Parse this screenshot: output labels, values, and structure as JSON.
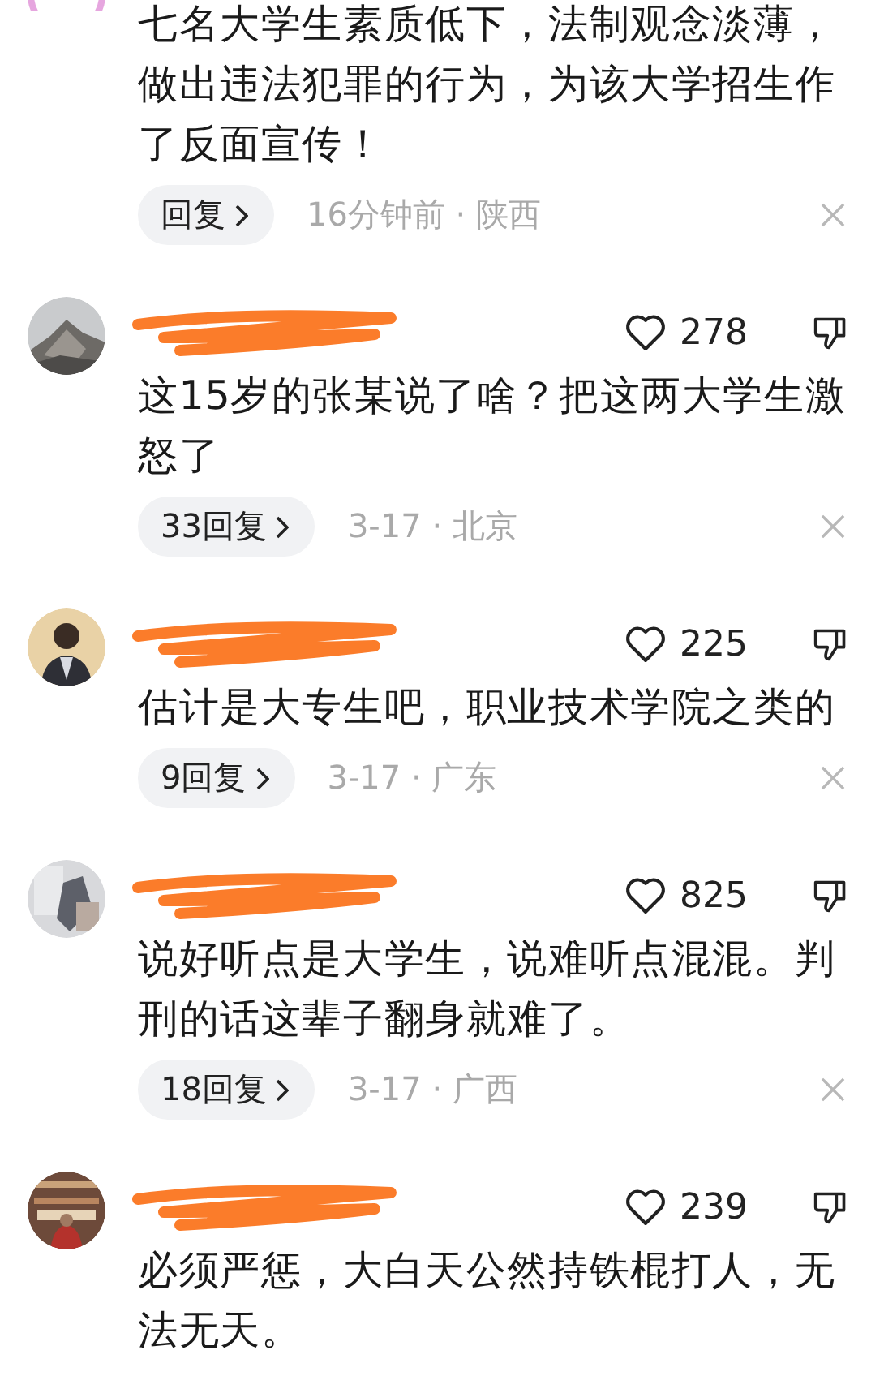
{
  "comments": [
    {
      "kind": "cut",
      "text": "七名大学生素质低下，法制观念淡薄，做出违法犯罪的行为，为该大学招生作了反面宣传！",
      "replies": "回复",
      "meta": "16分钟前 · 陕西"
    },
    {
      "kind": "full",
      "redacted": true,
      "likes": "278",
      "text": "这15岁的张某说了啥？把这两大学生激怒了",
      "replies": "33回复",
      "meta": "3-17 · 北京"
    },
    {
      "kind": "full",
      "redacted": true,
      "likes": "225",
      "text": "估计是大专生吧，职业技术学院之类的",
      "replies": "9回复",
      "meta": "3-17 · 广东"
    },
    {
      "kind": "full",
      "redacted": true,
      "likes": "825",
      "text": "说好听点是大学生，说难听点混混。判刑的话这辈子翻身就难了。",
      "replies": "18回复",
      "meta": "3-17 · 广西"
    },
    {
      "kind": "last",
      "redacted": true,
      "likes": "239",
      "text": "必须严惩，大白天公然持铁棍打人，无法无天。"
    }
  ]
}
